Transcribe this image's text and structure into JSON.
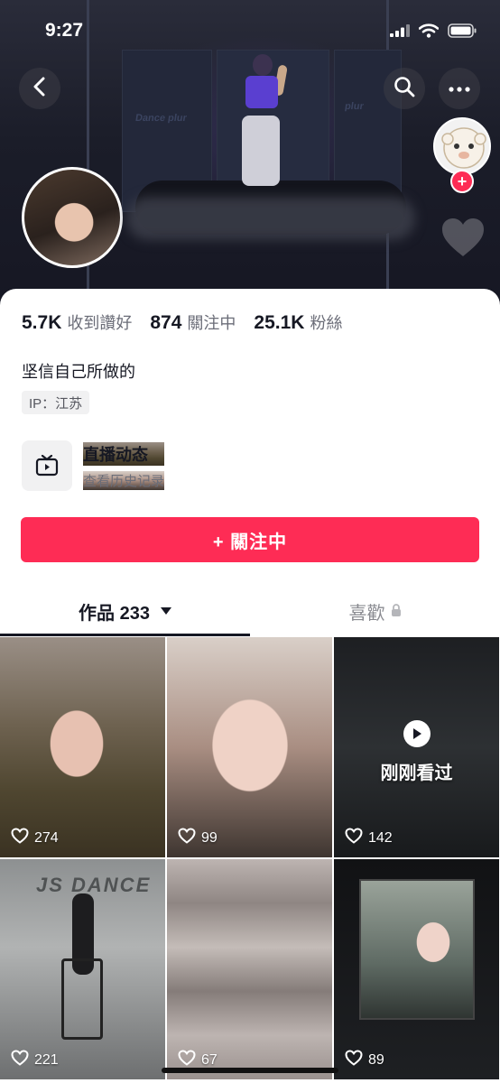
{
  "status_bar": {
    "time": "9:27"
  },
  "cover": {
    "wall_text_left": "Dance plur",
    "wall_text_right": "plur"
  },
  "stats": {
    "likes_num": "5.7K",
    "likes_label": "收到讚好",
    "following_num": "874",
    "following_label": "關注中",
    "followers_num": "25.1K",
    "followers_label": "粉絲"
  },
  "bio": "坚信自己所做的",
  "ip": "IP：江苏",
  "live": {
    "title": "直播动态",
    "subtitle": "查看历史记录"
  },
  "follow_button": "+ 關注中",
  "tabs": {
    "works": "作品 233",
    "likes": "喜歡"
  },
  "videos": [
    {
      "likes": "274"
    },
    {
      "likes": "99"
    },
    {
      "likes": "142",
      "badge": "刚刚看过"
    },
    {
      "likes": "221",
      "sign": "JS DANCE"
    },
    {
      "likes": "67"
    },
    {
      "likes": "89"
    }
  ],
  "colors": {
    "accent": "#fe2c55",
    "text": "#161823",
    "muted": "#6b6d78"
  }
}
